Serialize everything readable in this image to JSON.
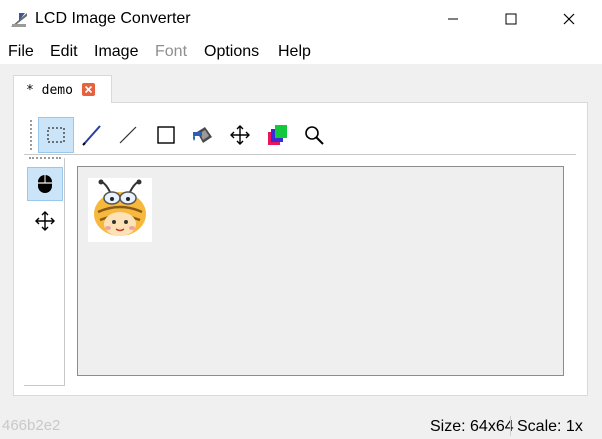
{
  "window": {
    "title": "LCD Image Converter",
    "app_icon": "pencil-ruler-icon",
    "controls": [
      "minimize-icon",
      "maximize-icon",
      "close-icon"
    ]
  },
  "menu": {
    "file": "File",
    "edit": "Edit",
    "image": "Image",
    "font": "Font",
    "options": "Options",
    "help": "Help"
  },
  "tab": {
    "label": "* demo",
    "close_icon": "close-icon",
    "close_color": "#e9603f"
  },
  "toolbar": {
    "tools": [
      "select-rect-icon",
      "pen-icon",
      "line-icon",
      "rectangle-icon",
      "fill-bucket-icon",
      "move-icon",
      "color-icon",
      "zoom-icon"
    ],
    "active": "select-rect-icon"
  },
  "side_toolbar": {
    "tools": [
      "mouse-icon",
      "move-icon"
    ],
    "active": "mouse-icon"
  },
  "canvas": {
    "image": "bee-face-image"
  },
  "status": {
    "size": "Size: 64x64",
    "scale": "Scale: 1x",
    "watermark": "466b2e2"
  },
  "colors": {
    "accent": "#cce4f7",
    "accent_border": "#99c8ee",
    "canvas_bg": "#efefef"
  }
}
